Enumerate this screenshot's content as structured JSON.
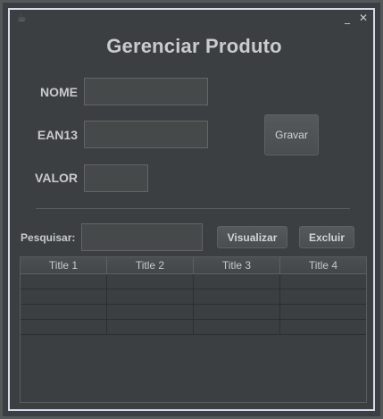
{
  "window": {
    "title": "",
    "icon": "java-cup-icon",
    "minimize_glyph": "_",
    "close_glyph": "✕"
  },
  "form": {
    "heading": "Gerenciar Produto",
    "nome_label": "NOME",
    "nome_value": "",
    "ean13_label": "EAN13",
    "ean13_value": "",
    "valor_label": "VALOR",
    "valor_value": "",
    "gravar_label": "Gravar"
  },
  "search": {
    "label": "Pesquisar:",
    "value": "",
    "visualizar_label": "Visualizar",
    "excluir_label": "Excluir"
  },
  "table": {
    "columns": [
      "Title 1",
      "Title 2",
      "Title 3",
      "Title 4"
    ],
    "rows": [
      [
        "",
        "",
        "",
        ""
      ],
      [
        "",
        "",
        "",
        ""
      ],
      [
        "",
        "",
        "",
        ""
      ],
      [
        "",
        "",
        "",
        ""
      ]
    ]
  },
  "colors": {
    "background": "#3c3f41",
    "frame_border": "#d7d9ec",
    "text": "#c8cacc"
  }
}
